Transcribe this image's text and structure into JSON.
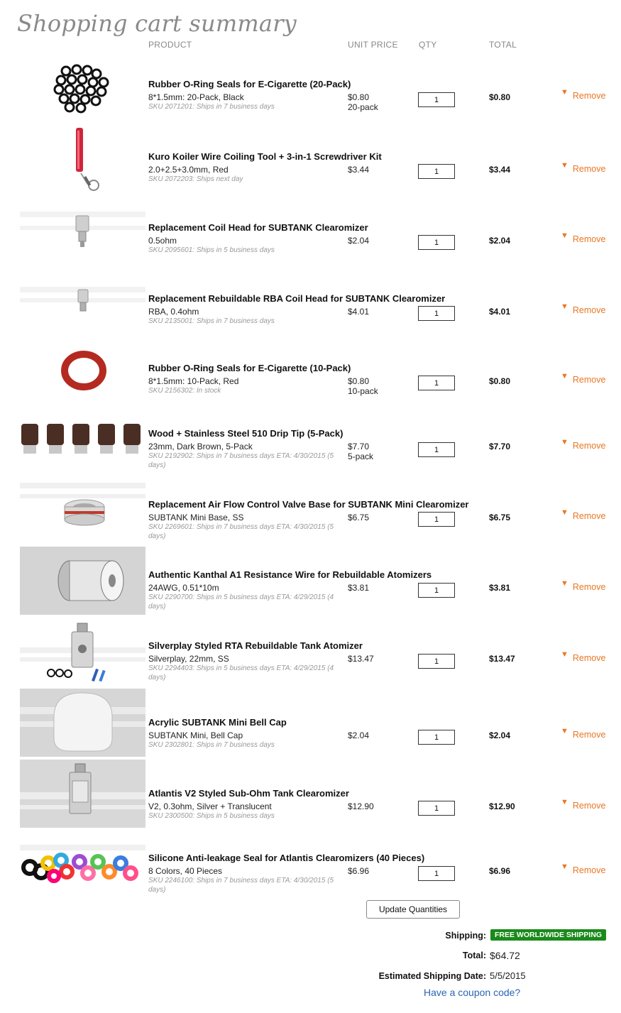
{
  "page": {
    "title": "Shopping cart summary",
    "columns": {
      "product": "PRODUCT",
      "unit_price": "UNIT PRICE",
      "qty": "QTY",
      "total": "TOTAL"
    }
  },
  "items": [
    {
      "name": "Rubber O-Ring Seals for E-Cigarette (20-Pack)",
      "option": "8*1.5mm: 20-Pack, Black",
      "sku": "SKU 2071201: Ships in 7 business days",
      "price": "$0.80",
      "price_note": "20-pack",
      "qty": "1",
      "total": "$0.80",
      "remove": "Remove",
      "thumb": "black-orings-icon"
    },
    {
      "name": "Kuro Koiler Wire Coiling Tool + 3-in-1 Screwdriver Kit",
      "option": "2.0+2.5+3.0mm, Red",
      "sku": "SKU 2072203: Ships next day",
      "price": "$3.44",
      "price_note": "",
      "qty": "1",
      "total": "$3.44",
      "remove": "Remove",
      "thumb": "coiling-tool-icon"
    },
    {
      "name": "Replacement Coil Head for SUBTANK Clearomizer",
      "option": "0.5ohm",
      "sku": "SKU 2095601: Ships in 5 business days",
      "price": "$2.04",
      "price_note": "",
      "qty": "1",
      "total": "$2.04",
      "remove": "Remove",
      "thumb": "coil-head-icon"
    },
    {
      "name": "Replacement Rebuildable RBA Coil Head for SUBTANK Clearomizer",
      "option": "RBA, 0.4ohm",
      "sku": "SKU 2135001: Ships in 7 business days",
      "price": "$4.01",
      "price_note": "",
      "qty": "1",
      "total": "$4.01",
      "remove": "Remove",
      "thumb": "rba-head-icon"
    },
    {
      "name": "Rubber O-Ring Seals for E-Cigarette (10-Pack)",
      "option": "8*1.5mm: 10-Pack, Red",
      "sku": "SKU 2156302: In stock",
      "price": "$0.80",
      "price_note": "10-pack",
      "qty": "1",
      "total": "$0.80",
      "remove": "Remove",
      "thumb": "red-oring-icon"
    },
    {
      "name": "Wood + Stainless Steel 510 Drip Tip (5-Pack)",
      "option": "23mm, Dark Brown, 5-Pack",
      "sku": "SKU 2192902: Ships in 7 business days ETA: 4/30/2015 (5 days)",
      "price": "$7.70",
      "price_note": "5-pack",
      "qty": "1",
      "total": "$7.70",
      "remove": "Remove",
      "thumb": "drip-tips-icon"
    },
    {
      "name": "Replacement Air Flow Control Valve Base for SUBTANK Mini Clearomizer",
      "option": "SUBTANK Mini Base, SS",
      "sku": "SKU 2269601: Ships in 7 business days ETA: 4/30/2015 (5 days)",
      "price": "$6.75",
      "price_note": "",
      "qty": "1",
      "total": "$6.75",
      "remove": "Remove",
      "thumb": "valve-base-icon"
    },
    {
      "name": "Authentic Kanthal A1 Resistance Wire for Rebuildable Atomizers",
      "option": "24AWG, 0.51*10m",
      "sku": "SKU 2290700: Ships in 5 business days ETA: 4/29/2015 (4 days)",
      "price": "$3.81",
      "price_note": "",
      "qty": "1",
      "total": "$3.81",
      "remove": "Remove",
      "thumb": "wire-spool-icon"
    },
    {
      "name": "Silverplay Styled RTA Rebuildable Tank Atomizer",
      "option": "Silverplay, 22mm, SS",
      "sku": "SKU 2294403: Ships in 5 business days ETA: 4/29/2015 (4 days)",
      "price": "$13.47",
      "price_note": "",
      "qty": "1",
      "total": "$13.47",
      "remove": "Remove",
      "thumb": "rta-tank-icon"
    },
    {
      "name": "Acrylic SUBTANK Mini Bell Cap",
      "option": "SUBTANK Mini, Bell Cap",
      "sku": "SKU 2302801: Ships in 7 business days",
      "price": "$2.04",
      "price_note": "",
      "qty": "1",
      "total": "$2.04",
      "remove": "Remove",
      "thumb": "bell-cap-icon"
    },
    {
      "name": "Atlantis V2 Styled Sub-Ohm Tank Clearomizer",
      "option": "V2, 0.3ohm, Silver + Translucent",
      "sku": "SKU 2300500: Ships in 5 business days",
      "price": "$12.90",
      "price_note": "",
      "qty": "1",
      "total": "$12.90",
      "remove": "Remove",
      "thumb": "atlantis-tank-icon"
    },
    {
      "name": "Silicone Anti-leakage Seal for Atlantis Clearomizers (40 Pieces)",
      "option": "8 Colors, 40 Pieces",
      "sku": "SKU 2246100: Ships in 7 business days ETA: 4/30/2015 (5 days)",
      "price": "$6.96",
      "price_note": "",
      "qty": "1",
      "total": "$6.96",
      "remove": "Remove",
      "thumb": "color-seals-icon"
    }
  ],
  "actions": {
    "update": "Update Quantities"
  },
  "summary": {
    "shipping_label": "Shipping:",
    "shipping_value": "FREE WORLDWIDE SHIPPING",
    "total_label": "Total:",
    "total_value": "$64.72",
    "eta_label": "Estimated Shipping Date:",
    "eta_value": "5/5/2015",
    "coupon_link": "Have a coupon code?"
  },
  "colors": {
    "remove": "#e87722",
    "shipping_badge": "#1a8a1a",
    "link": "#2a64b5",
    "title": "#8a8a8a"
  }
}
